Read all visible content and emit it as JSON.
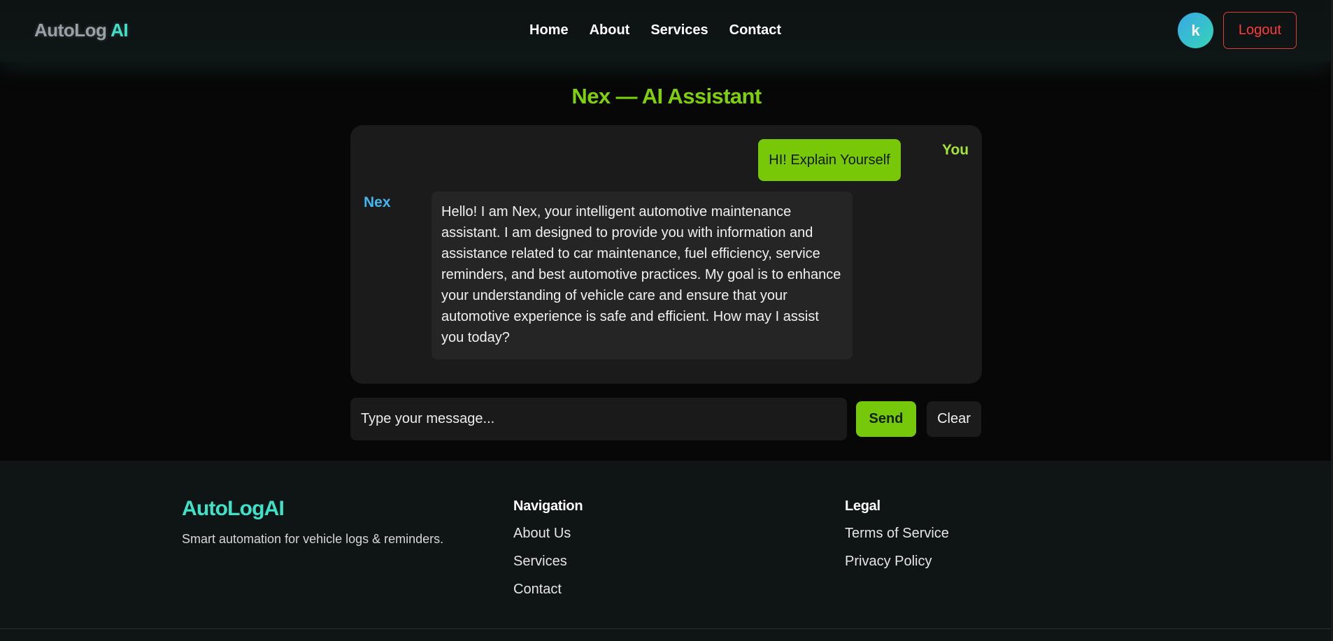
{
  "header": {
    "brand_part1": "AutoLog",
    "brand_part2": "AI",
    "nav": [
      "Home",
      "About",
      "Services",
      "Contact"
    ],
    "avatar_initial": "k",
    "logout_label": "Logout"
  },
  "chat": {
    "title": "Nex — AI Assistant",
    "messages": [
      {
        "sender": "You",
        "text": "HI! Explain Yourself"
      },
      {
        "sender": "Nex",
        "text": "Hello! I am Nex, your intelligent automotive maintenance assistant. I am designed to provide you with information and assistance related to car maintenance, fuel efficiency, service reminders, and best automotive practices. My goal is to enhance your understanding of vehicle care and ensure that your automotive experience is safe and efficient. How may I assist you today?"
      }
    ],
    "input_placeholder": "Type your message...",
    "send_label": "Send",
    "clear_label": "Clear"
  },
  "footer": {
    "brand": "AutoLogAI",
    "tagline": "Smart automation for vehicle logs & reminders.",
    "navigation_heading": "Navigation",
    "navigation_links": [
      "About Us",
      "Services",
      "Contact"
    ],
    "legal_heading": "Legal",
    "legal_links": [
      "Terms of Service",
      "Privacy Policy"
    ]
  },
  "colors": {
    "accent_green": "#78c808",
    "brand_teal": "#3ee2c8",
    "nex_blue": "#44b6ef",
    "logout_red": "#ff3b3b"
  }
}
